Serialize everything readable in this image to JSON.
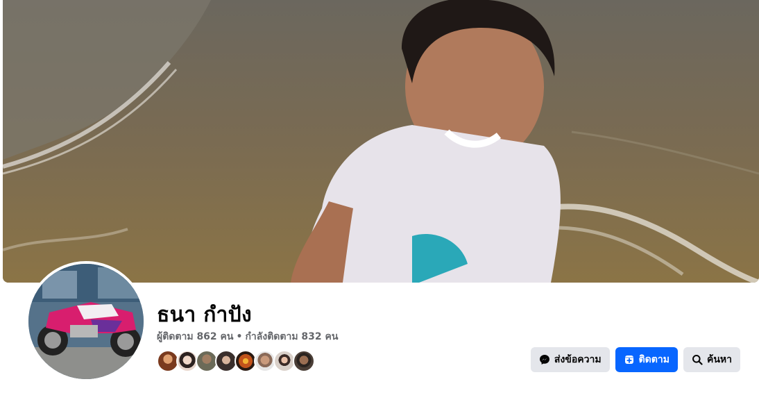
{
  "profile": {
    "name": "ธนา กำปัง",
    "followers_text": "ผู้ติดตาม 862 คน",
    "separator": "•",
    "following_text": "กำลังติดตาม 832 คน"
  },
  "friends_preview": [
    {
      "color": "#7a3a1e"
    },
    {
      "color": "#e8d6cc"
    },
    {
      "color": "#6b6a58"
    },
    {
      "color": "#3a2f2c"
    },
    {
      "color": "#c2531b"
    },
    {
      "color": "#8a6a58"
    },
    {
      "color": "#d9d0c9"
    },
    {
      "color": "#4a3e36"
    }
  ],
  "actions": {
    "message_label": "ส่งข้อความ",
    "follow_label": "ติดตาม",
    "search_label": "ค้นหา"
  },
  "colors": {
    "primary": "#0866ff",
    "secondary_button": "#e4e6eb",
    "text_primary": "#050505",
    "text_secondary": "#65676b"
  }
}
